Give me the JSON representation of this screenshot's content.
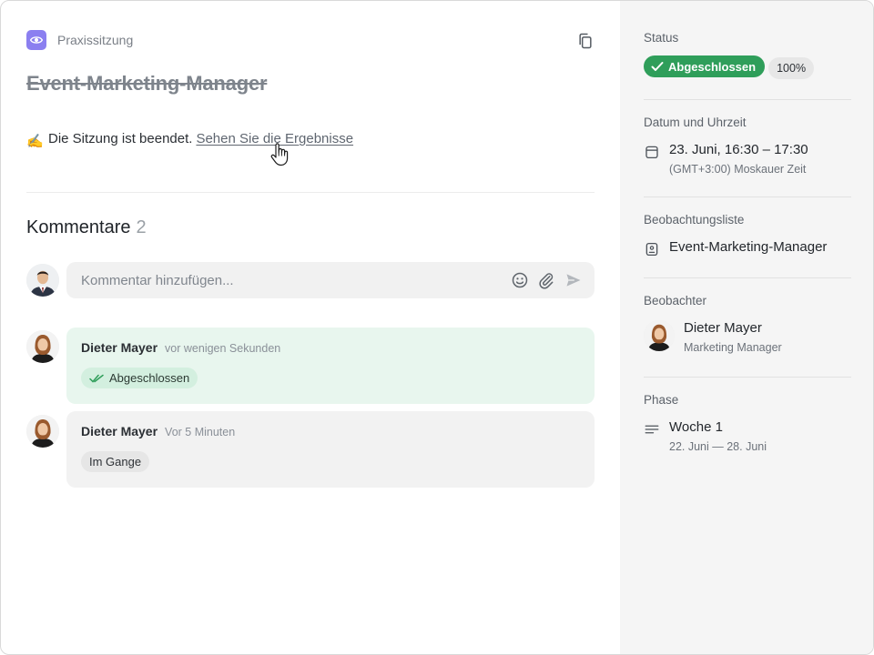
{
  "session": {
    "type_label": "Praxissitzung",
    "title": "Event-Marketing-Manager",
    "ended_emoji": "✍️",
    "ended_text": "Die Sitzung ist beendet.",
    "results_link": "Sehen Sie die Ergebnisse"
  },
  "comments": {
    "title": "Kommentare",
    "count": "2",
    "input_placeholder": "Kommentar hinzufügen...",
    "items": [
      {
        "author": "Dieter Mayer",
        "time": "vor wenigen Sekunden",
        "status": "Abgeschlossen"
      },
      {
        "author": "Dieter Mayer",
        "time": "Vor 5 Minuten",
        "status": "Im Gange"
      }
    ]
  },
  "sidebar": {
    "status": {
      "label": "Status",
      "value": "Abgeschlossen",
      "percent": "100%"
    },
    "datetime": {
      "label": "Datum und Uhrzeit",
      "value": "23. Juni, 16:30 – 17:30",
      "timezone": "(GMT+3:00) Moskauer Zeit"
    },
    "watchlist": {
      "label": "Beobachtungsliste",
      "value": "Event-Marketing-Manager"
    },
    "observer": {
      "label": "Beobachter",
      "name": "Dieter Mayer",
      "role": "Marketing Manager"
    },
    "phase": {
      "label": "Phase",
      "value": "Woche 1",
      "range": "22. Juni — 28. Juni"
    }
  },
  "colors": {
    "accent_purple": "#8b7ff0",
    "success_green": "#2f9e5a",
    "done_card_bg": "#e8f6ee",
    "sidebar_bg": "#f5f5f5"
  },
  "icons": {
    "type": "eye-icon",
    "copy": "copy-icon",
    "emoji": "smiley-icon",
    "attach": "paperclip-icon",
    "send": "send-icon",
    "calendar": "calendar-icon",
    "watchlist": "badge-icon",
    "phase": "lines-icon",
    "check": "check-icon",
    "double_check": "double-check-icon",
    "cursor": "hand-pointer-icon"
  }
}
